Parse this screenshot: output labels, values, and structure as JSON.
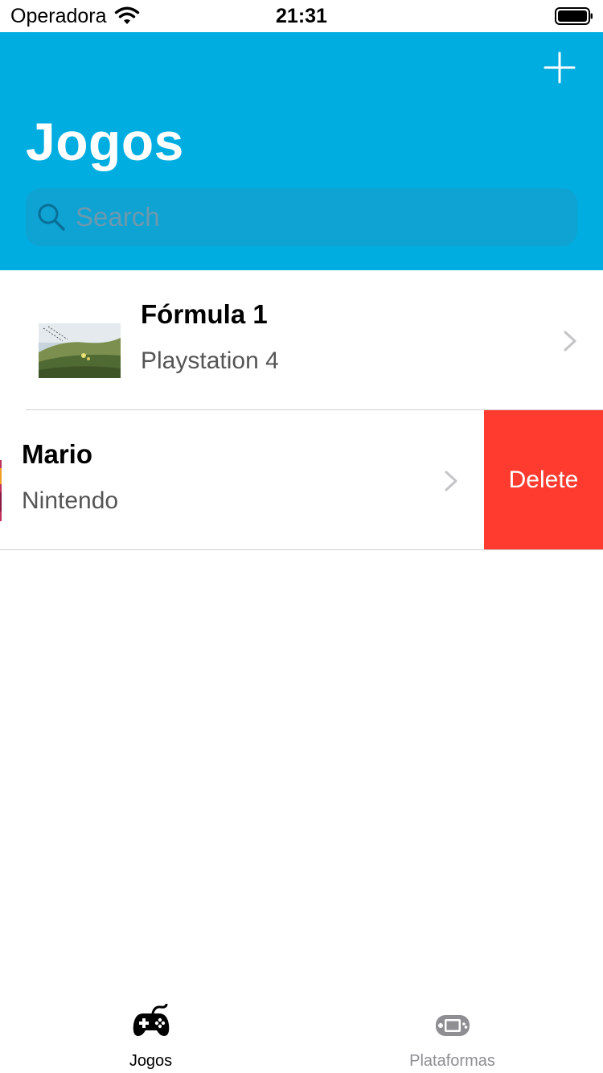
{
  "status_bar": {
    "carrier": "Operadora",
    "time": "21:31"
  },
  "header": {
    "title": "Jogos",
    "add_icon": "plus-icon",
    "background_color": "#00ADE0"
  },
  "search": {
    "placeholder": "Search",
    "value": ""
  },
  "games": [
    {
      "title": "Fórmula 1",
      "platform": "Playstation 4"
    },
    {
      "title": "Mario",
      "platform": "Nintendo"
    }
  ],
  "swipe_action": {
    "label": "Delete",
    "color": "#FF3B30"
  },
  "tabs": [
    {
      "label": "Jogos",
      "icon": "gamepad-icon",
      "selected": true
    },
    {
      "label": "Plataformas",
      "icon": "handheld-console-icon",
      "selected": false
    }
  ]
}
